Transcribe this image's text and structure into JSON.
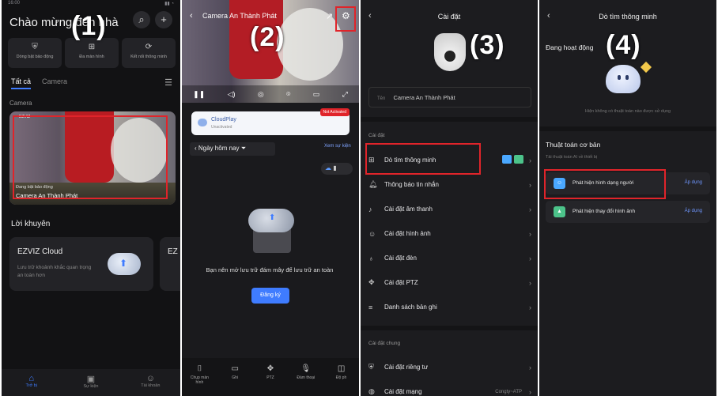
{
  "step_labels": [
    "(1)",
    "(2)",
    "(3)",
    "(4)"
  ],
  "panel1": {
    "welcome": "Chào mừng đến nhà",
    "shortcuts": [
      "Dòng bật bảo động",
      "Đa màn hình",
      "Kết nối thông minh"
    ],
    "tabs": [
      "Tất cả",
      "Camera"
    ],
    "camera_section": "Camera",
    "camera_status": "Đang bật bảo động",
    "camera_name": "Camera An Thành Phát",
    "tips_title": "Lời khuyên",
    "card_title": "EZVIZ Cloud",
    "card_desc": "Lưu trữ khoảnh khắc quan trọng an toàn hơn",
    "card2_title": "EZ",
    "nav": [
      "Trở bị",
      "Sự kiện",
      "Tài khoản"
    ]
  },
  "panel2": {
    "title": "Camera An Thành Phát",
    "cloud_title": "CloudPlay",
    "cloud_sub": "Unactivated",
    "cloud_badge": "Not Activated",
    "date": "Ngày hôm nay",
    "view_events": "Xem sự kiện",
    "message": "Bạn nên mở lưu trữ đám mây để lưu trữ an toàn",
    "register": "Đăng ký",
    "nav": [
      "Chụp màn hình",
      "Ghi",
      "PTZ",
      "Đàm thoại",
      "Độ ph"
    ]
  },
  "panel3": {
    "header": "Cài đặt",
    "name_label": "Tên",
    "name_value": "Camera An Thành Phát",
    "section1": "Cài đặt",
    "items": [
      "Dò tìm thông minh",
      "Thông báo tin nhắn",
      "Cài đặt âm thanh",
      "Cài đặt hình ảnh",
      "Cài đặt đèn",
      "Cài đặt PTZ",
      "Danh sách bản ghi"
    ],
    "section2": "Cài đặt chung",
    "items2": [
      "Cài đặt riêng tư",
      "Cài đặt mạng"
    ],
    "network_value": "Congty~ATP"
  },
  "panel4": {
    "header": "Dò tìm thông minh",
    "active_label": "Đang hoạt động",
    "no_function": "Hiện không có thuật toán nào được sử dụng",
    "basic_title": "Thuật toán cơ bản",
    "basic_sub": "Tải thuật toán AI về thiết bị",
    "algos": [
      "Phát hiện hình dạng người",
      "Phát hiện thay đổi hình ảnh"
    ],
    "apply": "Áp dụng"
  },
  "colors": {
    "accent": "#3f7cff",
    "highlight_red": "#e0242a"
  }
}
